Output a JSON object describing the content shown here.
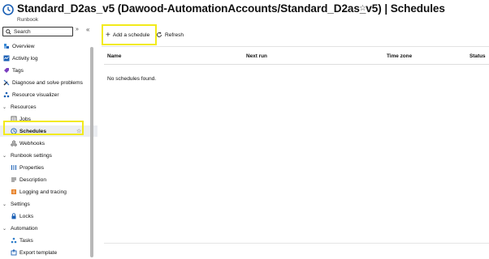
{
  "header": {
    "title": "Standard_D2as_v5 (Dawood-AutomationAccounts/Standard_D2as_v5) | Schedules",
    "subtitle": "Runbook",
    "icon": "clock-icon"
  },
  "sidebar": {
    "search_placeholder": "Search",
    "items": [
      {
        "label": "Overview",
        "icon": "overview-icon"
      },
      {
        "label": "Activity log",
        "icon": "activity-log-icon"
      },
      {
        "label": "Tags",
        "icon": "tag-icon"
      },
      {
        "label": "Diagnose and solve problems",
        "icon": "wrench-icon"
      },
      {
        "label": "Resource visualizer",
        "icon": "visualizer-icon"
      },
      {
        "label": "Resources",
        "section": true
      },
      {
        "label": "Jobs",
        "icon": "jobs-icon"
      },
      {
        "label": "Schedules",
        "icon": "clock-icon",
        "selected": true
      },
      {
        "label": "Webhooks",
        "icon": "webhook-icon"
      },
      {
        "label": "Runbook settings",
        "section": true
      },
      {
        "label": "Properties",
        "icon": "properties-icon"
      },
      {
        "label": "Description",
        "icon": "description-icon"
      },
      {
        "label": "Logging and tracing",
        "icon": "logging-icon"
      },
      {
        "label": "Settings",
        "section": true
      },
      {
        "label": "Locks",
        "icon": "lock-icon"
      },
      {
        "label": "Automation",
        "section": true
      },
      {
        "label": "Tasks",
        "icon": "tasks-icon"
      },
      {
        "label": "Export template",
        "icon": "export-icon"
      }
    ]
  },
  "toolbar": {
    "add_label": "Add a schedule",
    "refresh_label": "Refresh"
  },
  "grid": {
    "columns": [
      "Name",
      "Next run",
      "Time zone",
      "Status"
    ],
    "empty_text": "No schedules found."
  },
  "colors": {
    "highlight": "#f2ea1a",
    "accent": "#0f6cbd",
    "selected_bg": "#eceef2"
  }
}
